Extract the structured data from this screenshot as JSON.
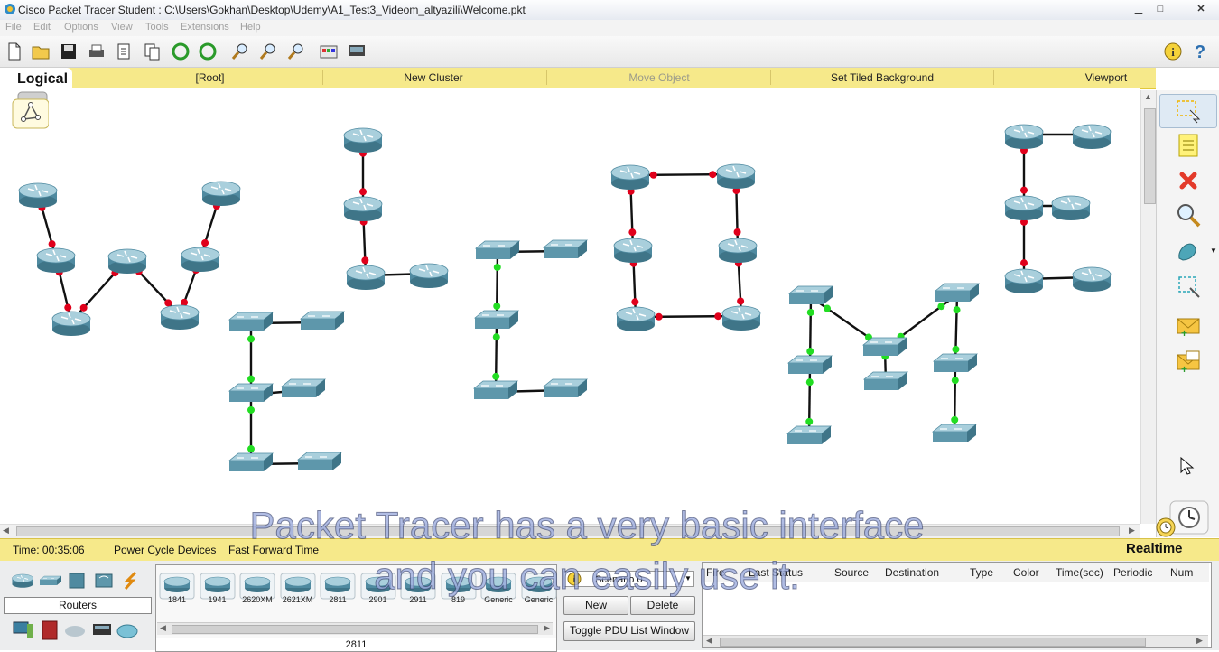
{
  "window": {
    "title": "Cisco Packet Tracer Student : C:\\Users\\Gokhan\\Desktop\\Udemy\\A1_Test3_Videom_altyazili\\Welcome.pkt"
  },
  "menu": [
    "File",
    "Edit",
    "Options",
    "View",
    "Tools",
    "Extensions",
    "Help"
  ],
  "workspace_bar": {
    "mode": "Logical",
    "items": [
      "[Root]",
      "New Cluster",
      "Move Object",
      "Set Tiled Background",
      "Viewport"
    ]
  },
  "status": {
    "time": "Time: 00:35:06",
    "power_cycle": "Power Cycle Devices",
    "fast_forward": "Fast Forward Time",
    "mode": "Realtime"
  },
  "bottom": {
    "category": "Routers",
    "devices": [
      "1841",
      "1941",
      "2620XM",
      "2621XM",
      "2811",
      "2901",
      "2911",
      "819",
      "Generic",
      "Generic"
    ],
    "selected_device": "2811",
    "scenario": "Scenario 0",
    "new_button": "New",
    "delete_button": "Delete",
    "toggle_button": "Toggle PDU List Window",
    "pdu_columns": [
      "Fire",
      "Last Status",
      "Source",
      "Destination",
      "Type",
      "Color",
      "Time(sec)",
      "Periodic",
      "Num"
    ]
  },
  "subtitles": {
    "line1": "Packet Tracer has a very basic interface",
    "line2": "and you can easily use it."
  },
  "colors": {
    "workspace_bar": "#f6e98a",
    "link_red": "#e0001b",
    "link_green": "#22dd22",
    "device": "#6aa0b4"
  }
}
